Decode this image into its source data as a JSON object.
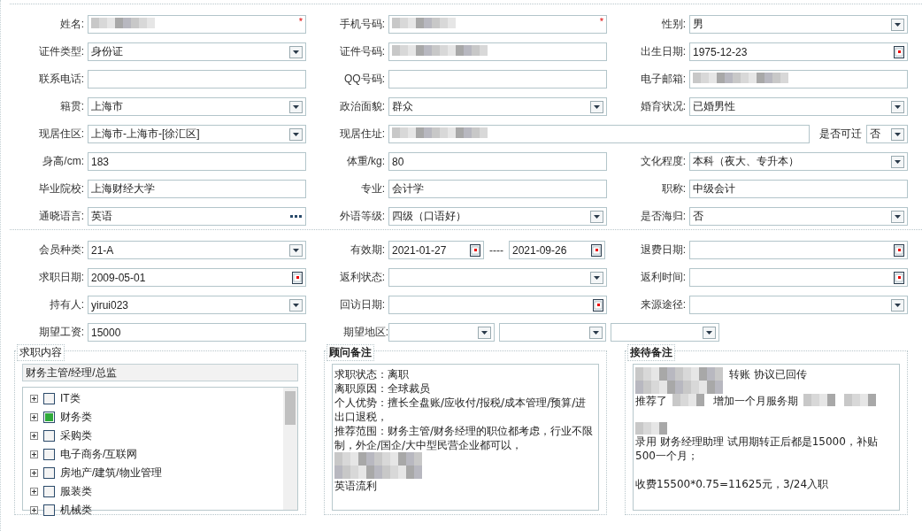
{
  "sections": [
    {
      "rows": [
        {
          "cells": [
            {
              "kind": "single",
              "label": "姓名:",
              "field": {
                "kind": "text",
                "redacted": true,
                "required_mark": "*"
              }
            },
            {
              "kind": "single",
              "label": "手机号码:",
              "field": {
                "kind": "text",
                "redacted": true,
                "required_mark": "*"
              }
            },
            {
              "kind": "single",
              "label": "性别:",
              "field": {
                "kind": "select",
                "value": "男"
              }
            }
          ]
        },
        {
          "cells": [
            {
              "kind": "single",
              "label": "证件类型:",
              "field": {
                "kind": "select",
                "value": "身份证"
              }
            },
            {
              "kind": "single",
              "label": "证件号码:",
              "field": {
                "kind": "text",
                "redacted": true
              }
            },
            {
              "kind": "single",
              "label": "出生日期:",
              "field": {
                "kind": "date",
                "value": "1975-12-23"
              }
            }
          ]
        },
        {
          "cells": [
            {
              "kind": "single",
              "label": "联系电话:",
              "field": {
                "kind": "text"
              }
            },
            {
              "kind": "single",
              "label": "QQ号码:",
              "field": {
                "kind": "text"
              }
            },
            {
              "kind": "single",
              "label": "电子邮箱:",
              "field": {
                "kind": "text",
                "redacted": true
              }
            }
          ]
        },
        {
          "cells": [
            {
              "kind": "single",
              "label": "籍贯:",
              "field": {
                "kind": "select",
                "value": "上海市"
              }
            },
            {
              "kind": "single",
              "label": "政治面貌:",
              "field": {
                "kind": "select",
                "value": "群众"
              }
            },
            {
              "kind": "single",
              "label": "婚育状况:",
              "field": {
                "kind": "select",
                "value": "已婚男性"
              }
            }
          ]
        },
        {
          "cells": [
            {
              "kind": "single",
              "label": "现居住区:",
              "field": {
                "kind": "select",
                "value": " 上海市-上海市-[徐汇区]"
              }
            },
            {
              "kind": "wide",
              "label": "现居住址:",
              "field": {
                "kind": "text",
                "redacted": true
              },
              "extra_label": "是否可迁",
              "extra_field": {
                "kind": "select",
                "value": "否"
              }
            }
          ]
        },
        {
          "cells": [
            {
              "kind": "single",
              "label": "身高/cm:",
              "field": {
                "kind": "text",
                "value": "183"
              }
            },
            {
              "kind": "single",
              "label": "体重/kg:",
              "field": {
                "kind": "text",
                "value": "80"
              }
            },
            {
              "kind": "single",
              "label": "文化程度:",
              "field": {
                "kind": "select",
                "value": "本科（夜大、专升本）"
              }
            }
          ]
        },
        {
          "cells": [
            {
              "kind": "single",
              "label": "毕业院校:",
              "field": {
                "kind": "text",
                "value": "上海财经大学"
              }
            },
            {
              "kind": "single",
              "label": "专业:",
              "field": {
                "kind": "text",
                "value": "会计学"
              }
            },
            {
              "kind": "single",
              "label": "职称:",
              "field": {
                "kind": "text",
                "value": "中级会计"
              }
            }
          ]
        },
        {
          "cells": [
            {
              "kind": "single",
              "label": "通晓语言:",
              "field": {
                "kind": "lookup",
                "value": "英语"
              }
            },
            {
              "kind": "single",
              "label": "外语等级:",
              "field": {
                "kind": "select",
                "value": "四级（口语好）"
              }
            },
            {
              "kind": "single",
              "label": "是否海归:",
              "field": {
                "kind": "select",
                "value": "否"
              }
            }
          ]
        }
      ]
    },
    {
      "rows": [
        {
          "cells": [
            {
              "kind": "single",
              "label": "会员种类:",
              "field": {
                "kind": "select",
                "value": " 21-A"
              }
            },
            {
              "kind": "range",
              "label": "有效期:",
              "from": {
                "kind": "date",
                "value": "2021-01-27"
              },
              "separator": "----",
              "to": {
                "kind": "date",
                "value": "2021-09-26"
              }
            },
            {
              "kind": "single",
              "label": "退费日期:",
              "field": {
                "kind": "date"
              }
            }
          ]
        },
        {
          "cells": [
            {
              "kind": "single",
              "label": "求职日期:",
              "field": {
                "kind": "date",
                "value": "2009-05-01"
              }
            },
            {
              "kind": "single",
              "label": "返利状态:",
              "field": {
                "kind": "select"
              }
            },
            {
              "kind": "single",
              "label": "返利时间:",
              "field": {
                "kind": "date"
              }
            }
          ]
        },
        {
          "cells": [
            {
              "kind": "single",
              "label": "持有人:",
              "field": {
                "kind": "select",
                "value": "yirui023"
              }
            },
            {
              "kind": "single",
              "label": "回访日期:",
              "field": {
                "kind": "date"
              }
            },
            {
              "kind": "single",
              "label": "来源途径:",
              "field": {
                "kind": "select"
              }
            }
          ]
        },
        {
          "cells": [
            {
              "kind": "single",
              "label": "期望工资:",
              "field": {
                "kind": "text",
                "value": "15000"
              }
            },
            {
              "kind": "triple",
              "label": "期望地区:",
              "fields": [
                {
                  "kind": "select"
                },
                {
                  "kind": "select"
                },
                {
                  "kind": "select"
                }
              ]
            }
          ]
        }
      ]
    }
  ],
  "job_panel": {
    "title": "求职内容",
    "selected_text": "财务主管/经理/总监",
    "tree": [
      {
        "label": "IT类",
        "expanded": false,
        "checked": false
      },
      {
        "label": "财务类",
        "expanded": false,
        "checked": true
      },
      {
        "label": "采购类",
        "expanded": false,
        "checked": false
      },
      {
        "label": "电子商务/互联网",
        "expanded": false,
        "checked": false
      },
      {
        "label": "房地产/建筑/物业管理",
        "expanded": false,
        "checked": false
      },
      {
        "label": "服装类",
        "expanded": false,
        "checked": false
      },
      {
        "label": "机械类",
        "expanded": false,
        "checked": false
      }
    ]
  },
  "notes": [
    {
      "title": "顾问备注",
      "lines": [
        {
          "segments": [
            {
              "kind": "text",
              "text": "求职状态：离职"
            }
          ]
        },
        {
          "segments": [
            {
              "kind": "text",
              "text": "离职原因：全球裁员"
            }
          ]
        },
        {
          "segments": [
            {
              "kind": "text",
              "text": "个人优势：擅长全盘账/应收付/报税/成本管理/预算/进出口退税，"
            }
          ]
        },
        {
          "segments": [
            {
              "kind": "text",
              "text": "推荐范围：财务主管/财务经理的职位都考虑，行业不限制，外企/国企/大中型民营企业都可以，"
            }
          ]
        },
        {
          "segments": [
            {
              "kind": "blur_block"
            }
          ]
        },
        {
          "segments": [
            {
              "kind": "text",
              "text": "英语流利"
            }
          ]
        }
      ]
    },
    {
      "title": "接待备注",
      "lines": [
        {
          "segments": [
            {
              "kind": "blur_block"
            },
            {
              "kind": "text",
              "text": "转账  协议已回传"
            }
          ]
        },
        {
          "segments": [
            {
              "kind": "text",
              "text": "推荐了"
            },
            {
              "kind": "blur"
            },
            {
              "kind": "text",
              "text": "增加一个月服务期"
            },
            {
              "kind": "blur"
            },
            {
              "kind": "blur"
            }
          ]
        },
        {
          "gap": true,
          "segments": [
            {
              "kind": "blur"
            },
            {
              "kind": "text",
              "text": "录用   财务经理助理   试用期转正后都是15000，补贴500一个月；"
            }
          ]
        },
        {
          "gap": true,
          "segments": [
            {
              "kind": "text",
              "text": "收费15500*0.75=11625元，3/24入职"
            }
          ]
        }
      ]
    }
  ]
}
